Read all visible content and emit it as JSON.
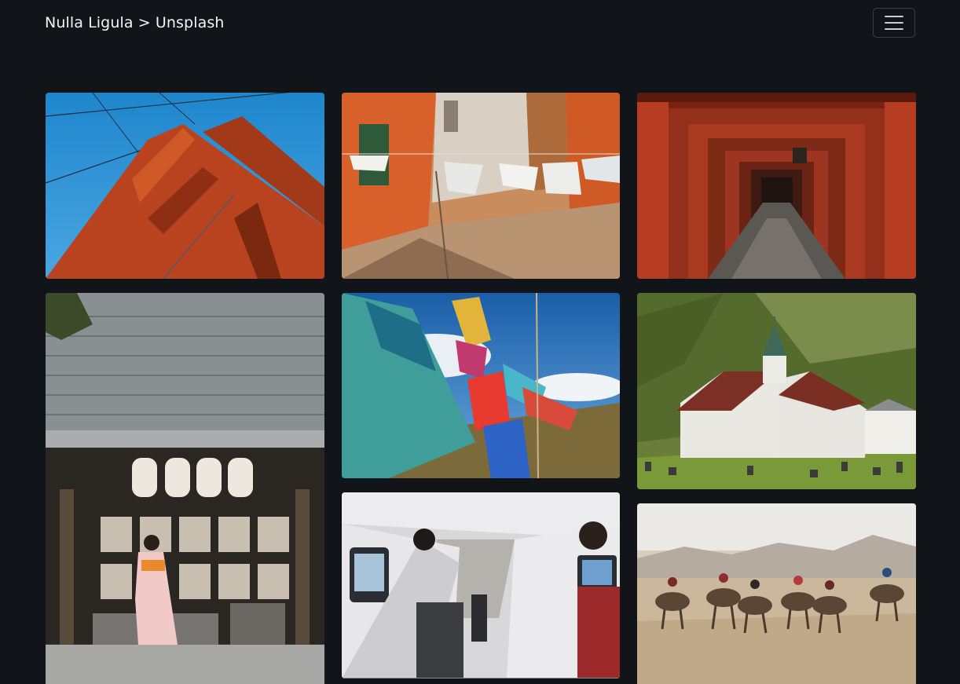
{
  "navbar": {
    "brand": "Nulla Ligula > Unsplash",
    "toggler_icon": "hamburger-menu-icon"
  },
  "gallery": {
    "photos": [
      {
        "subject": "golden-gate-bridge-tower",
        "accent": "#c1461f"
      },
      {
        "subject": "laundry-lines-courtyard",
        "accent": "#d8652b"
      },
      {
        "subject": "torii-gate-tunnel",
        "accent": "#b2391f"
      },
      {
        "subject": "japanese-shrine-kimono",
        "accent": "#6e7377"
      },
      {
        "subject": "prayer-flags-sky",
        "accent": "#2c7fc3"
      },
      {
        "subject": "white-church-mountains",
        "accent": "#5f7a2f"
      },
      {
        "subject": "airplane-cabin-aisle",
        "accent": "#d9d9dc"
      },
      {
        "subject": "camel-caravan-desert",
        "accent": "#c9b59a"
      }
    ]
  }
}
